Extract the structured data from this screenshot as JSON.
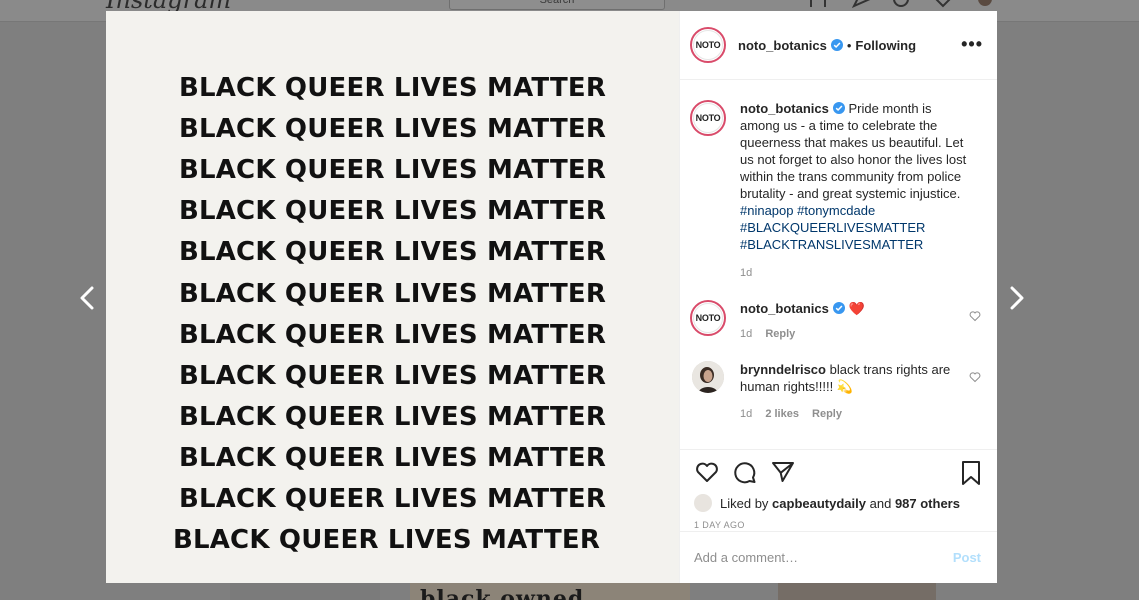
{
  "background": {
    "logo_text": "Instagram",
    "search_placeholder": "Search",
    "thumb_text": "black owned"
  },
  "colors": {
    "overlay": "#7f7f7f",
    "link": "#00376b",
    "verified": "#3897f0",
    "heart": "#ed4956",
    "post_disabled": "#b2dffc"
  },
  "media": {
    "lines": [
      "BLACK QUEER LIVES MATTER",
      "BLACK QUEER LIVES MATTER",
      "BLACK QUEER LIVES MATTER",
      "BLACK QUEER LIVES MATTER",
      "BLACK QUEER LIVES MATTER",
      "BLACK QUEER LIVES MATTER",
      "BLACK QUEER LIVES MATTER",
      "BLACK QUEER LIVES MATTER",
      "BLACK QUEER LIVES MATTER",
      "BLACK QUEER LIVES MATTER",
      "BLACK QUEER LIVES MATTER",
      "BLACK QUEER LIVES MATTER"
    ]
  },
  "header": {
    "avatar_text": "NOTO",
    "username": "noto_botanics",
    "separator": "•",
    "follow_status": "Following",
    "more": "•••"
  },
  "caption": {
    "avatar_text": "NOTO",
    "username": "noto_botanics",
    "text": "Pride month is among us - a time to celebrate the queerness that makes us beautiful. Let us not forget to also honor the lives lost within the trans community from police brutality - and great systemic injustice.",
    "hashtags": [
      "#ninapop",
      "#tonymcdade",
      "#BLACKQUEERLIVESMATTER",
      "#BLACKTRANSLIVESMATTER"
    ],
    "time": "1d"
  },
  "comments": [
    {
      "avatar_text": "NOTO",
      "username": "noto_botanics",
      "text": "❤️",
      "time": "1d",
      "reply": "Reply"
    },
    {
      "username": "brynndelrisco",
      "text": "black trans rights are human rights!!!!! 💫",
      "time": "1d",
      "likes": "2 likes",
      "reply": "Reply"
    }
  ],
  "actions": {
    "liked_prefix": "Liked by",
    "liked_user": "capbeautydaily",
    "liked_and": "and",
    "liked_others": "987 others",
    "date": "1 DAY AGO"
  },
  "add_comment": {
    "placeholder": "Add a comment…",
    "post_label": "Post"
  }
}
